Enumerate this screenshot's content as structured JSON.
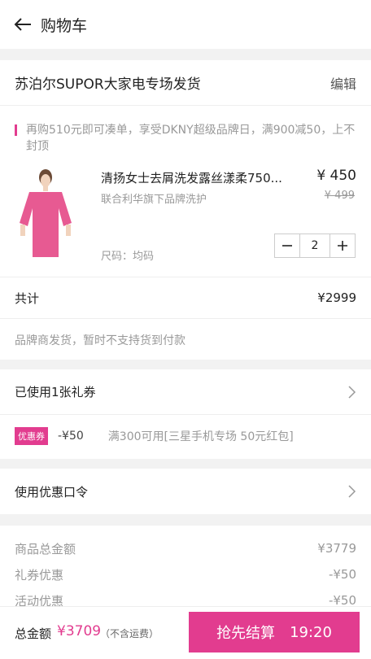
{
  "header": {
    "title": "购物车"
  },
  "shop": {
    "name": "苏泊尔SUPOR大家电专场发货",
    "edit_label": "编辑"
  },
  "promo": {
    "text": "再购510元即可凑单，享受DKNY超级品牌日，满900减50，上不封顶"
  },
  "product": {
    "name": "清扬女士去屑洗发露丝漾柔750...",
    "subtitle": "联合利华旗下品牌洗护",
    "size_label": "尺码：均码",
    "price": "¥ 450",
    "original_price": "¥ 499",
    "quantity": "2",
    "image_color": "#e75a92"
  },
  "subtotal": {
    "label": "共计",
    "value": "¥2999"
  },
  "shipping_note": "品牌商发货，暂时不支持货到付款",
  "coupon": {
    "label": "已使用1张礼券",
    "badge": "优惠券",
    "amount": "-¥50",
    "description": "满300可用[三星手机专场 50元红包]"
  },
  "promo_code": {
    "label": "使用优惠口令"
  },
  "summary": {
    "rows": [
      {
        "label": "商品总金额",
        "value": "¥3779"
      },
      {
        "label": "礼券优惠",
        "value": "-¥50"
      },
      {
        "label": "活动优惠",
        "value": "-¥50"
      }
    ]
  },
  "footer": {
    "total_label": "总金额",
    "total_value": "¥3709",
    "shipping_note": "（不含运费）",
    "checkout_label": "抢先结算",
    "checkout_time": "19:20"
  },
  "colors": {
    "accent": "#e23c8f"
  }
}
